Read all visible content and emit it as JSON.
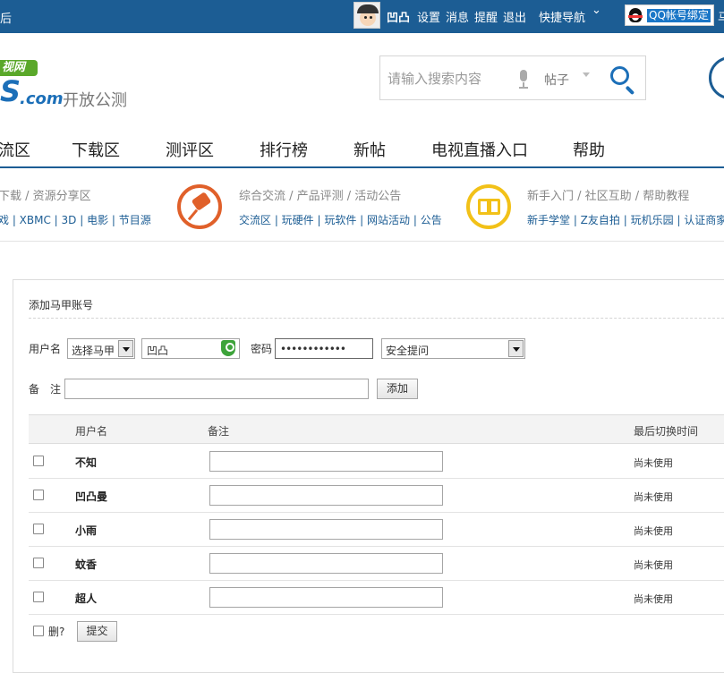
{
  "topbar": {
    "left_text": "后",
    "user_name": "凹凸",
    "links": [
      "设置",
      "消息",
      "提醒",
      "退出"
    ],
    "quick_nav": "快捷导航",
    "qq_bind": "QQ帐号绑定",
    "trunc": "马"
  },
  "header": {
    "logo_badge": "视网",
    "logo_s": "S",
    "logo_com": ".com",
    "beta": "开放公测",
    "search_placeholder": "请输入搜索内容",
    "search_scope": "帖子"
  },
  "mainnav": [
    "流区",
    "下载区",
    "测评区",
    "排行榜",
    "新帖",
    "电视直播入口",
    "帮助"
  ],
  "categories": [
    {
      "title": "下载 / 资源分享区",
      "links": "戏 | XBMC | 3D | 电影 | 节目源"
    },
    {
      "title": "综合交流 / 产品评测 / 活动公告",
      "links": "交流区 | 玩硬件 | 玩软件 | 网站活动 | 公告"
    },
    {
      "title": "新手入门 / 社区互助 / 帮助教程",
      "links": "新手学堂 | Z友自拍 | 玩机乐园 | 认证商家"
    }
  ],
  "form": {
    "title": "添加马甲账号",
    "username_label": "用户名",
    "select_majia": "选择马甲",
    "username_value": "凹凸",
    "password_label": "密码",
    "password_value": "••••••••••••",
    "security_question": "安全提问",
    "note_label": "备　注",
    "add_button": "添加"
  },
  "table": {
    "headers": {
      "username": "用户名",
      "note": "备注",
      "last_switch": "最后切换时间"
    },
    "rows": [
      {
        "name": "不知",
        "time": "尚未使用"
      },
      {
        "name": "凹凸曼",
        "time": "尚未使用"
      },
      {
        "name": "小雨",
        "time": "尚未使用"
      },
      {
        "name": "蚊香",
        "time": "尚未使用"
      },
      {
        "name": "超人",
        "time": "尚未使用"
      }
    ],
    "delete_label": "删?",
    "submit_button": "提交"
  }
}
